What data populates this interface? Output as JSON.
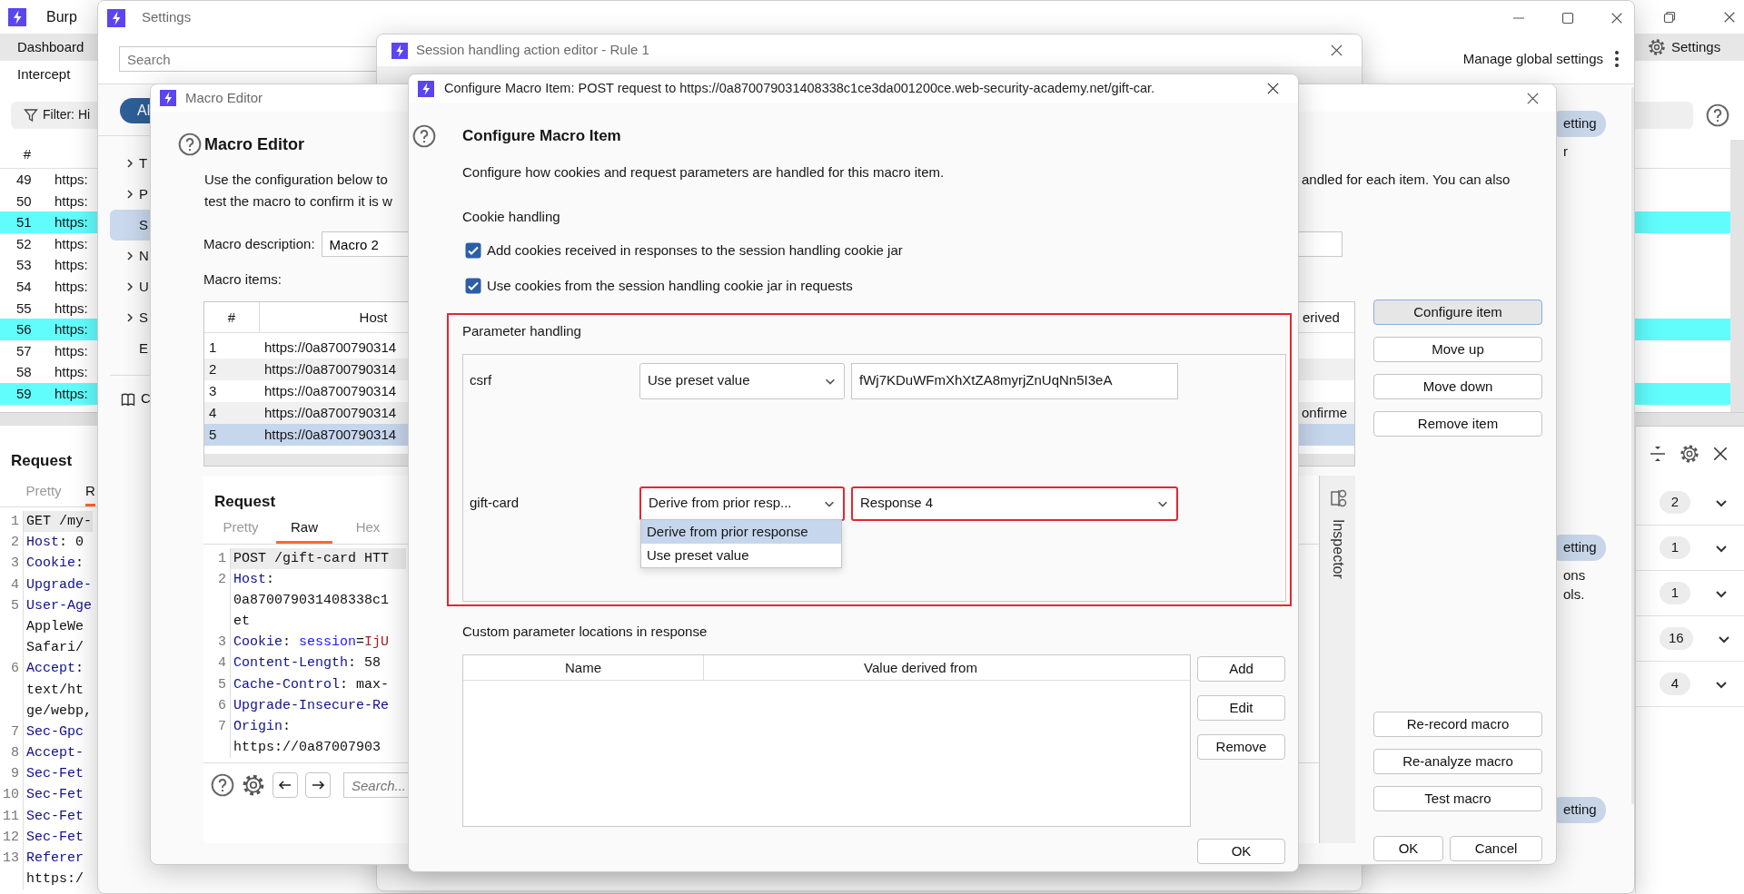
{
  "burp": {
    "title": "Burp",
    "tabs": [
      {
        "label": "Dashboard",
        "selected": true
      },
      {
        "label": "Intercept",
        "selected": false
      }
    ],
    "settings_button": "Settings",
    "filter": "Filter: Hi",
    "history": {
      "columns": [
        "#"
      ],
      "rows": [
        {
          "num": "49",
          "host": "https:",
          "highlighted": false
        },
        {
          "num": "50",
          "host": "https:",
          "highlighted": false
        },
        {
          "num": "51",
          "host": "https:",
          "highlighted": true
        },
        {
          "num": "52",
          "host": "https:",
          "highlighted": false
        },
        {
          "num": "53",
          "host": "https:",
          "highlighted": false
        },
        {
          "num": "54",
          "host": "https:",
          "highlighted": false
        },
        {
          "num": "55",
          "host": "https:",
          "highlighted": false
        },
        {
          "num": "56",
          "host": "https:",
          "highlighted": true
        },
        {
          "num": "57",
          "host": "https:",
          "highlighted": false
        },
        {
          "num": "58",
          "host": "https:",
          "highlighted": false
        },
        {
          "num": "59",
          "host": "https:",
          "highlighted": true
        }
      ]
    },
    "request": {
      "title": "Request",
      "tabs": [
        {
          "label": "Pretty",
          "selected": false
        },
        {
          "label": "R",
          "selected": true
        }
      ],
      "lines": [
        {
          "num": "1",
          "current": true,
          "parts": [
            {
              "kind": "plain",
              "text": "GET /my-"
            }
          ]
        },
        {
          "num": "2",
          "current": false,
          "parts": [
            {
              "kind": "key",
              "text": "Host"
            },
            {
              "kind": "plain",
              "text": ": 0"
            }
          ]
        },
        {
          "num": "3",
          "current": false,
          "parts": [
            {
              "kind": "key",
              "text": "Cookie"
            },
            {
              "kind": "plain",
              "text": ":"
            }
          ]
        },
        {
          "num": "4",
          "current": false,
          "parts": [
            {
              "kind": "key",
              "text": "Upgrade-"
            }
          ]
        },
        {
          "num": "5",
          "current": false,
          "parts": [
            {
              "kind": "key",
              "text": "User-Age"
            }
          ]
        },
        {
          "current": false,
          "parts": [
            {
              "kind": "plain",
              "text": "AppleWe"
            }
          ]
        },
        {
          "current": false,
          "parts": [
            {
              "kind": "plain",
              "text": "Safari/"
            }
          ]
        },
        {
          "num": "6",
          "current": false,
          "parts": [
            {
              "kind": "key",
              "text": "Accept"
            },
            {
              "kind": "plain",
              "text": ":"
            }
          ]
        },
        {
          "current": false,
          "parts": [
            {
              "kind": "plain",
              "text": "text/ht"
            }
          ]
        },
        {
          "current": false,
          "parts": [
            {
              "kind": "plain",
              "text": "ge/webp,"
            }
          ]
        },
        {
          "num": "7",
          "current": false,
          "parts": [
            {
              "kind": "key",
              "text": "Sec-Gpc"
            }
          ]
        },
        {
          "num": "8",
          "current": false,
          "parts": [
            {
              "kind": "key",
              "text": "Accept-"
            }
          ]
        },
        {
          "num": "9",
          "current": false,
          "parts": [
            {
              "kind": "key",
              "text": "Sec-Fet"
            }
          ]
        },
        {
          "num": "10",
          "current": false,
          "parts": [
            {
              "kind": "key",
              "text": "Sec-Fet"
            }
          ]
        },
        {
          "num": "11",
          "current": false,
          "parts": [
            {
              "kind": "key",
              "text": "Sec-Fet"
            }
          ]
        },
        {
          "num": "12",
          "current": false,
          "parts": [
            {
              "kind": "key",
              "text": "Sec-Fet"
            }
          ]
        },
        {
          "num": "13",
          "current": false,
          "parts": [
            {
              "kind": "key",
              "text": "Referer"
            }
          ]
        },
        {
          "current": false,
          "parts": [
            {
              "kind": "plain",
              "text": "https:/"
            }
          ]
        }
      ]
    },
    "issue_counts": [
      "2",
      "1",
      "1",
      "16",
      "4"
    ]
  },
  "settings_window": {
    "title": "Settings",
    "search": {
      "placeholder": "Search"
    },
    "manage_link": "Manage global settings",
    "filter_pill": "Al",
    "nav": [
      {
        "label": "T",
        "expandable": true,
        "selected": false
      },
      {
        "label": "P",
        "expandable": true,
        "selected": false
      },
      {
        "label": "S",
        "expandable": false,
        "selected": true
      },
      {
        "label": "N",
        "expandable": true,
        "selected": false
      },
      {
        "label": "U",
        "expandable": true,
        "selected": false
      },
      {
        "label": "S",
        "expandable": true,
        "selected": false
      },
      {
        "label": "E",
        "expandable": false,
        "selected": false
      }
    ],
    "docs_link": "C",
    "fragments": [
      {
        "kind": "pill",
        "text": "etting"
      },
      {
        "kind": "text",
        "text": "r"
      },
      {
        "kind": "pill",
        "text": "etting"
      },
      {
        "kind": "text",
        "text": "ons"
      },
      {
        "kind": "text",
        "text": "ols."
      },
      {
        "kind": "pill",
        "text": "etting"
      }
    ]
  },
  "session_editor": {
    "title": "Session handling action editor - Rule 1"
  },
  "macro_editor": {
    "title": "Macro Editor",
    "heading": "Macro Editor",
    "description_parts": [
      "Use the configuration below to",
      "test the macro to confirm it is w",
      "andled for each item. You can also"
    ],
    "description_label": "Macro description:",
    "description_value": "Macro 2",
    "items_label": "Macro items:",
    "items": {
      "columns": [
        "#",
        "Host",
        "erived"
      ],
      "rows": [
        {
          "num": "1",
          "host": "https://0a8700790314",
          "selected": false
        },
        {
          "num": "2",
          "host": "https://0a8700790314",
          "selected": false
        },
        {
          "num": "3",
          "host": "https://0a8700790314",
          "selected": false
        },
        {
          "num": "4",
          "host": "https://0a8700790314",
          "tail": "onfirme",
          "selected": false
        },
        {
          "num": "5",
          "host": "https://0a8700790314",
          "selected": true
        }
      ]
    },
    "request": {
      "title": "Request",
      "tabs": [
        {
          "label": "Pretty",
          "selected": false
        },
        {
          "label": "Raw",
          "selected": true
        },
        {
          "label": "Hex",
          "selected": false
        }
      ],
      "lines": [
        {
          "num": "1",
          "current": true,
          "parts": [
            {
              "kind": "plain",
              "text": "POST /gift-card HTT"
            }
          ]
        },
        {
          "num": "2",
          "current": false,
          "parts": [
            {
              "kind": "key",
              "text": "Host"
            },
            {
              "kind": "plain",
              "text": ":"
            }
          ]
        },
        {
          "current": false,
          "parts": [
            {
              "kind": "plain",
              "text": "0a870079031408338c1"
            }
          ]
        },
        {
          "current": false,
          "parts": [
            {
              "kind": "plain",
              "text": "et"
            }
          ]
        },
        {
          "num": "3",
          "current": false,
          "parts": [
            {
              "kind": "key",
              "text": "Cookie"
            },
            {
              "kind": "plain",
              "text": ": "
            },
            {
              "kind": "name",
              "text": "session"
            },
            {
              "kind": "plain",
              "text": "="
            },
            {
              "kind": "value",
              "text": "IjU"
            }
          ]
        },
        {
          "num": "4",
          "current": false,
          "parts": [
            {
              "kind": "key",
              "text": "Content-Length"
            },
            {
              "kind": "plain",
              "text": ": 58"
            }
          ]
        },
        {
          "num": "5",
          "current": false,
          "parts": [
            {
              "kind": "key",
              "text": "Cache-Control"
            },
            {
              "kind": "plain",
              "text": ": max-"
            }
          ]
        },
        {
          "num": "6",
          "current": false,
          "parts": [
            {
              "kind": "key",
              "text": "Upgrade-Insecure-Re"
            }
          ]
        },
        {
          "num": "7",
          "current": false,
          "parts": [
            {
              "kind": "key",
              "text": "Origin"
            },
            {
              "kind": "plain",
              "text": ":"
            }
          ]
        },
        {
          "current": false,
          "parts": [
            {
              "kind": "plain",
              "text": "https://0a87007903"
            }
          ]
        }
      ],
      "search": {
        "placeholder": "Search..."
      }
    },
    "inspector": "Inspector",
    "item_buttons": [
      {
        "label": "Configure item",
        "focused": true
      },
      {
        "label": "Move up",
        "focused": false
      },
      {
        "label": "Move down",
        "focused": false
      },
      {
        "label": "Remove item",
        "focused": false
      }
    ],
    "macro_buttons": [
      "Re-record macro",
      "Re-analyze macro",
      "Test macro"
    ],
    "dialog_buttons": [
      "OK",
      "Cancel"
    ]
  },
  "configure_item": {
    "title": "Configure Macro Item: POST request to https://0a870079031408338c1ce3da001200ce.web-security-academy.net/gift-car.",
    "heading": "Configure Macro Item",
    "description": "Configure how cookies and request parameters are handled for this macro item.",
    "cookie_heading": "Cookie handling",
    "cookie_options": [
      {
        "label": "Add cookies received in responses to the session handling cookie jar",
        "checked": true
      },
      {
        "label": "Use cookies from the session handling cookie jar in requests",
        "checked": true
      }
    ],
    "parameter_handling": {
      "title": "Parameter handling",
      "highlighted": true,
      "params": [
        {
          "name": "csrf",
          "kind": "preset",
          "mode": "Use preset value",
          "value": "fWj7KDuWFmXhXtZA8myrjZnUqNn5I3eA",
          "highlighted": false
        },
        {
          "name": "gift-card",
          "kind": "derived",
          "mode": "Derive from prior resp...",
          "source": "Response 4",
          "highlighted": true,
          "options": [
            {
              "label": "Derive from prior response",
              "selected": true
            },
            {
              "label": "Use preset value",
              "selected": false
            }
          ]
        }
      ]
    },
    "custom_locations": {
      "title": "Custom parameter locations in response",
      "columns": [
        "Name",
        "Value derived from"
      ],
      "buttons": [
        "Add",
        "Edit",
        "Remove"
      ]
    },
    "ok": "OK"
  }
}
